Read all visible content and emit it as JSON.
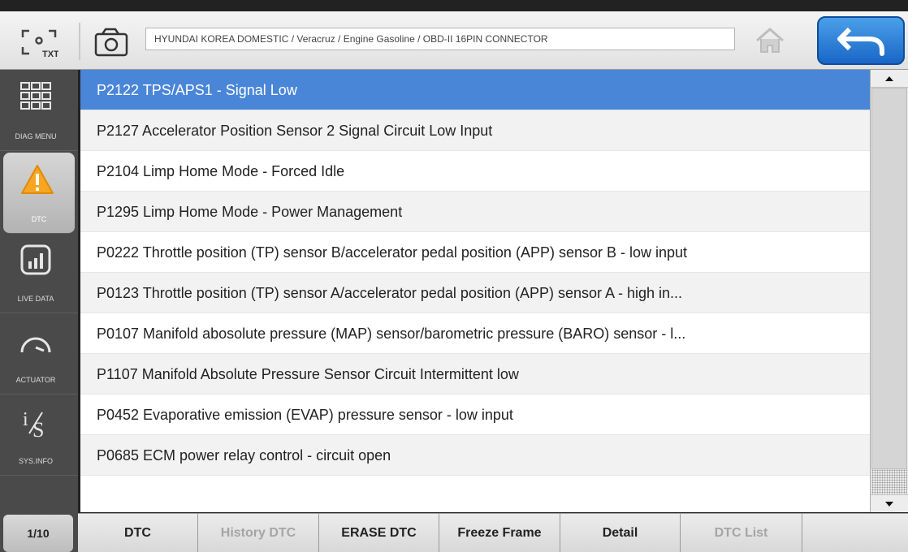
{
  "header": {
    "txt_icon_label": "TXT",
    "breadcrumb": "HYUNDAI KOREA DOMESTIC / Veracruz / Engine Gasoline / OBD-II 16PIN CONNECTOR"
  },
  "sidebar": {
    "items": [
      {
        "label": "DIAG MENU",
        "icon": "grid-icon"
      },
      {
        "label": "DTC",
        "icon": "warning-icon",
        "active": true
      },
      {
        "label": "LIVE DATA",
        "icon": "bar-chart-icon"
      },
      {
        "label": "ACTUATOR",
        "icon": "gauge-icon"
      },
      {
        "label": "SYS.INFO",
        "icon": "info-is-icon"
      }
    ],
    "page_indicator": "1/10"
  },
  "dtc_list": [
    "P2122 TPS/APS1 - Signal Low",
    "P2127 Accelerator Position Sensor 2 Signal Circuit Low Input",
    "P2104 Limp Home Mode - Forced Idle",
    "P1295 Limp Home Mode - Power Management",
    "P0222 Throttle position (TP) sensor B/accelerator pedal position (APP) sensor B - low input",
    "P0123 Throttle position (TP) sensor A/accelerator pedal position (APP) sensor A - high in...",
    "P0107 Manifold abosolute pressure (MAP) sensor/barometric pressure (BARO) sensor - l...",
    "P1107 Manifold Absolute Pressure Sensor Circuit Intermittent low",
    "P0452 Evaporative emission (EVAP) pressure sensor - low input",
    "P0685 ECM power relay control - circuit open"
  ],
  "tabs": {
    "dtc": "DTC",
    "history_dtc": "History DTC",
    "erase_dtc": "ERASE DTC",
    "freeze_frame": "Freeze Frame",
    "detail": "Detail",
    "dtc_list": "DTC List"
  },
  "colors": {
    "selected_row": "#4a86d8",
    "back_button": "#2a7fd9",
    "warning": "#f5a623"
  }
}
